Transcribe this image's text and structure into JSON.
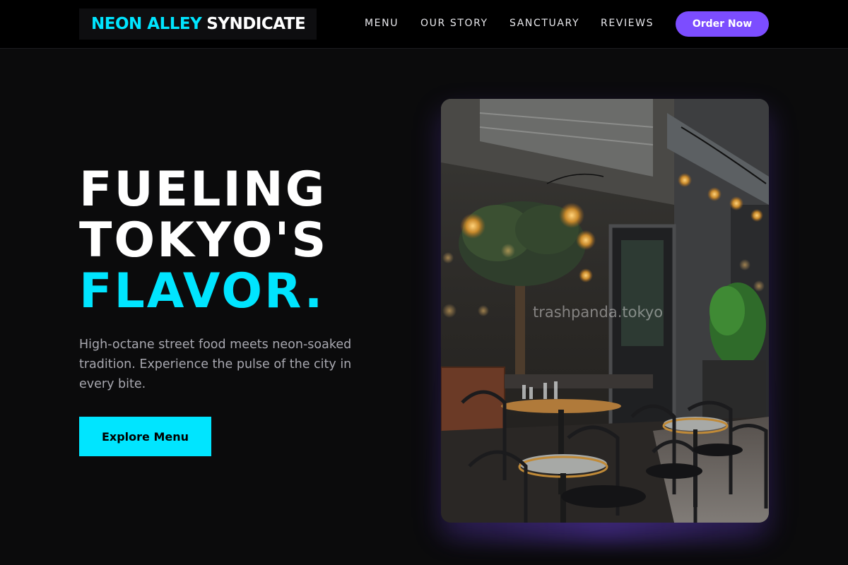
{
  "header": {
    "logo": {
      "part1": "NEON ALLEY",
      "part2": "SYNDICATE"
    },
    "nav_links": [
      "MENU",
      "OUR STORY",
      "SANCTUARY",
      "REVIEWS"
    ],
    "cta_label": "Order Now"
  },
  "hero": {
    "title_line1": "FUELING",
    "title_line2": "TOKYO'S",
    "title_line3": "FLAVOR.",
    "subtitle": "High-octane street food meets neon-soaked tradition. Experience the pulse of the city in every bite.",
    "button_label": "Explore Menu",
    "image_watermark": "trashpanda.tokyo"
  },
  "colors": {
    "accent_cyan": "#00e5ff",
    "accent_purple": "#7c4dff",
    "background": "#0b0b0c"
  },
  "icons": {
    "hero_image": "restaurant-terrace-photo"
  }
}
